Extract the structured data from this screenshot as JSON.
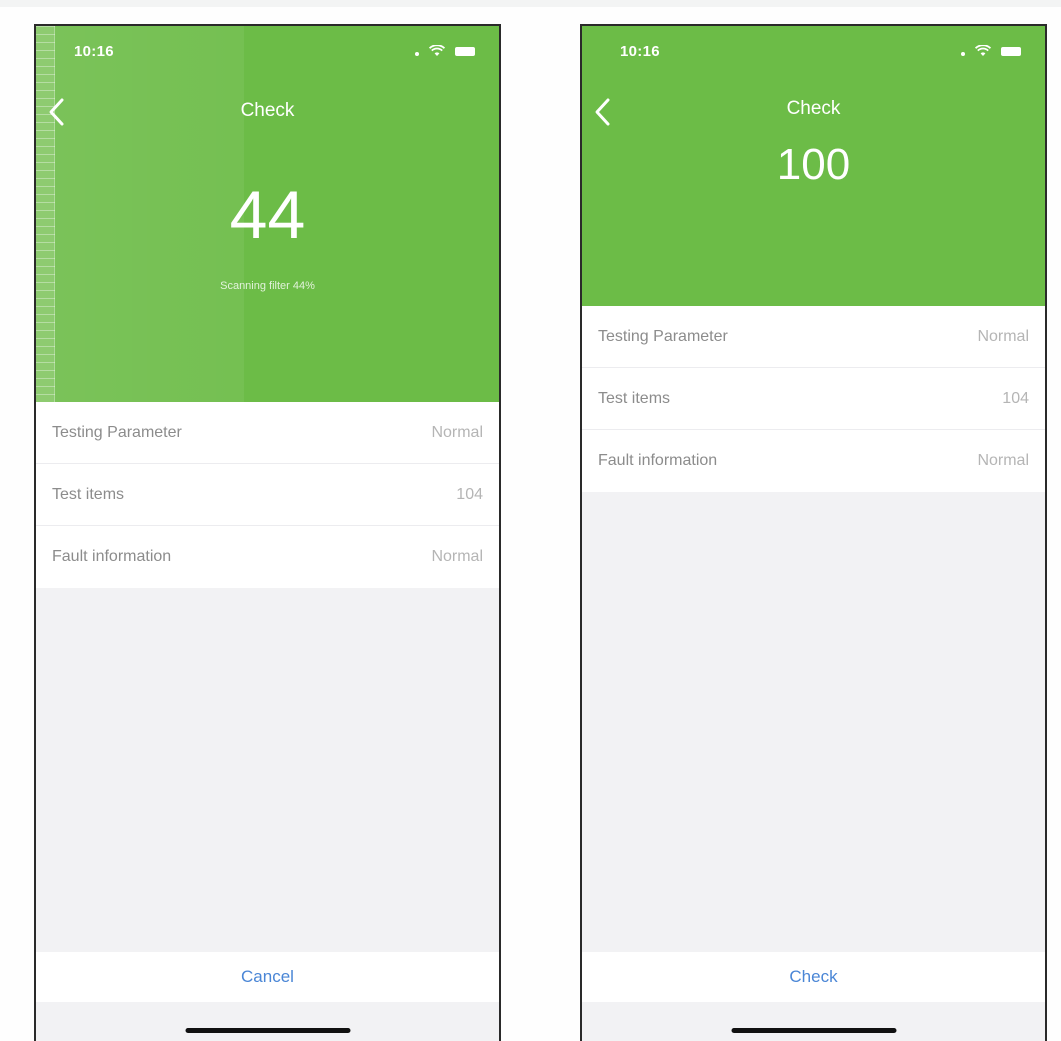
{
  "screens": [
    {
      "status_time": "10:16",
      "nav_title": "Check",
      "big_number": "44",
      "progress_text": "Scanning filter 44%",
      "rows": [
        {
          "label": "Testing Parameter",
          "value": "Normal"
        },
        {
          "label": "Test items",
          "value": "104"
        },
        {
          "label": "Fault information",
          "value": "Normal"
        }
      ],
      "bottom_button": "Cancel"
    },
    {
      "status_time": "10:16",
      "nav_title": "Check",
      "big_number": "100",
      "rows": [
        {
          "label": "Testing Parameter",
          "value": "Normal"
        },
        {
          "label": "Test items",
          "value": "104"
        },
        {
          "label": "Fault information",
          "value": "Normal"
        }
      ],
      "bottom_button": "Check"
    }
  ],
  "colors": {
    "hero_green": "#6cbc47",
    "button_blue": "#4a86d6",
    "background": "#f2f2f4"
  },
  "icons": [
    "back-chevron-icon",
    "signal-dot-icon",
    "wifi-icon",
    "battery-icon"
  ]
}
